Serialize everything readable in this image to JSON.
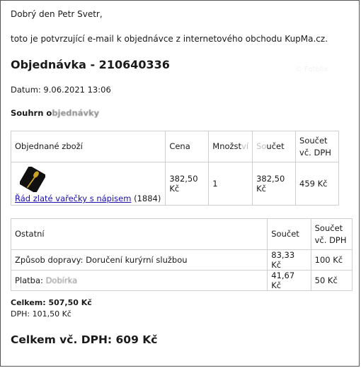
{
  "email": {
    "greeting": "Dobrý den Petr Svetr,",
    "intro": "toto je potvrzující e-mail k objednávce z internetového obchodu KupMa.cz.",
    "order_title": "Objednávka - 210640336",
    "ghost_text": "© Fotolia",
    "date": "Datum: 9.06.2021 13:06",
    "summary_heading": {
      "visible": "Souhrn o",
      "smudged": "bjednávky"
    }
  },
  "items_table": {
    "headers": {
      "product": "Objednané zboží",
      "price": "Cena",
      "quantity_visible": "Množst",
      "quantity_faded": "ví",
      "sum_faded": "So",
      "sum_visible": "učet",
      "sum_vat": "Součet vč. DPH"
    },
    "rows": [
      {
        "product_name": "Řád zlaté vařečky s nápisem",
        "product_code": "(1884)",
        "price": "382,50 Kč",
        "quantity": "1",
        "sum": "382,50 Kč",
        "sum_vat": "459 Kč",
        "image_icon": "golden-spoon-icon"
      }
    ]
  },
  "other_table": {
    "headers": {
      "other": "Ostatní",
      "sum": "Součet",
      "sum_vat": "Součet vč. DPH"
    },
    "rows": [
      {
        "label": "Způsob dopravy: Doručení kurýrní službou",
        "sum": "83,33 Kč",
        "sum_vat": "100 Kč"
      },
      {
        "label_prefix": "Platba:",
        "label_smudged": "Dobírka",
        "sum": "41,67 Kč",
        "sum_vat": "50 Kč"
      }
    ]
  },
  "totals": {
    "net": "Celkem: 507,50 Kč",
    "vat": "DPH: 101,50 Kč",
    "grand": "Celkem vč. DPH: 609 Kč"
  },
  "colors": {
    "link": "#1a0dab",
    "border": "#cfcfcf",
    "text": "#1a1a1a",
    "spoon_gold": "#c9a227"
  }
}
